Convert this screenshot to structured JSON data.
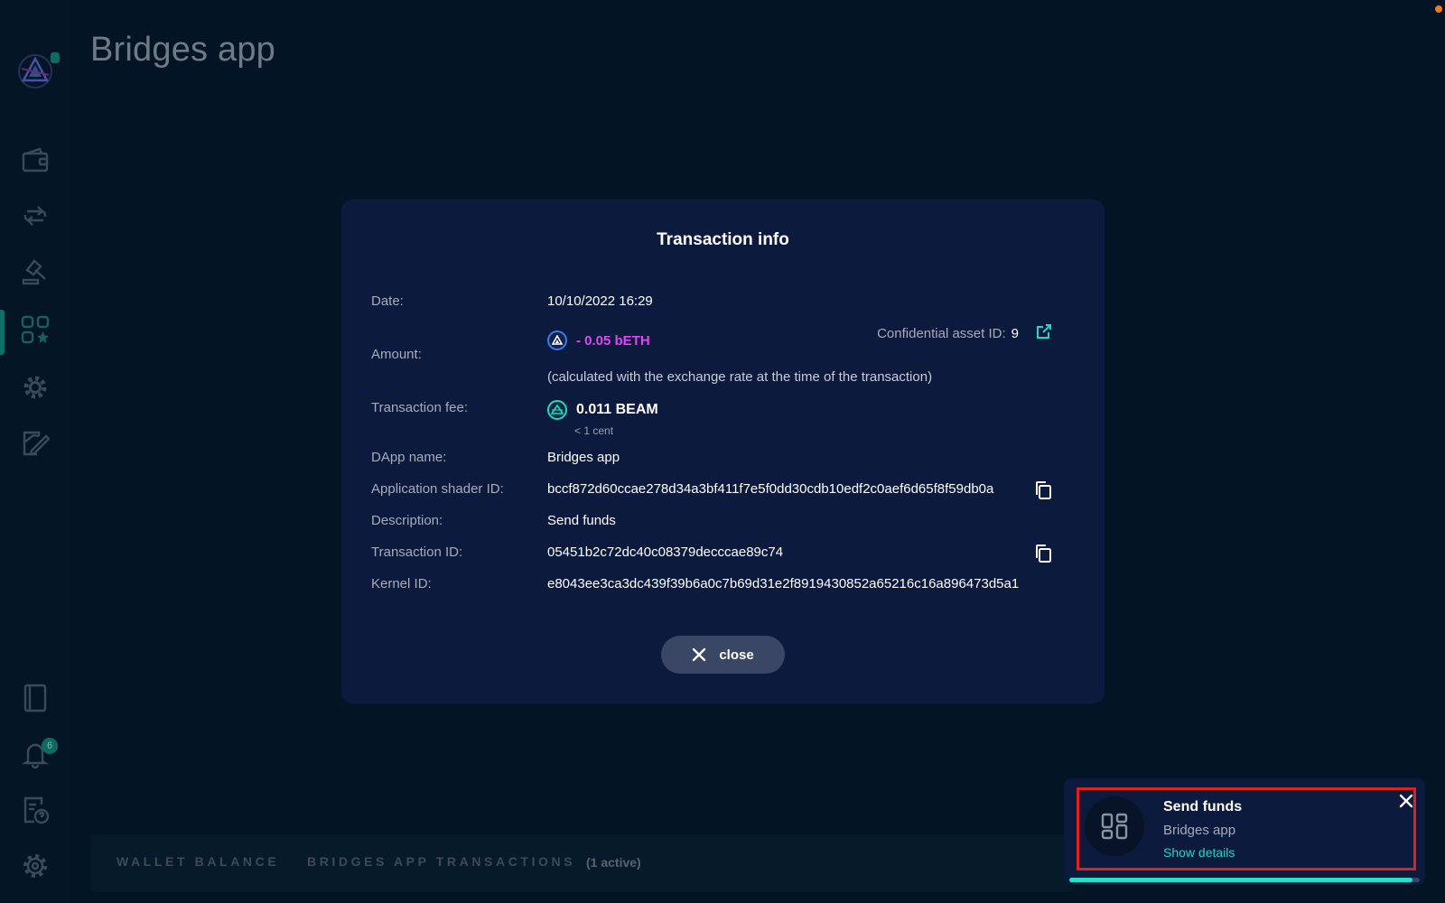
{
  "app": {
    "title": "Bridges app",
    "notifications_count": "6",
    "tabs": [
      "WALLET BALANCE",
      "BRIDGES APP TRANSACTIONS"
    ],
    "active_count": "(1 active)"
  },
  "sidebar": {
    "items": [
      "wallet",
      "transactions",
      "dao",
      "dapps",
      "settings-gear",
      "sign",
      "notes",
      "notifications",
      "help",
      "settings"
    ]
  },
  "modal": {
    "title": "Transaction info",
    "date_label": "Date:",
    "date_value": "10/10/2022  16:29",
    "amount_label": "Amount:",
    "amount_value": "- 0.05  bETH",
    "asset_label": "Confidential asset ID:",
    "asset_value": "9",
    "amount_note": "(calculated with the exchange rate at the time of the transaction)",
    "fee_label": "Transaction fee:",
    "fee_value": "0.011  BEAM",
    "fee_sub": "< 1 cent",
    "dapp_label": "DApp name:",
    "dapp_value": "Bridges app",
    "shader_label": "Application shader ID:",
    "shader_value": "bccf872d60ccae278d34a3bf411f7e5f0dd30cdb10edf2c0aef6d65f8f59db0a",
    "desc_label": "Description:",
    "desc_value": "Send funds",
    "txid_label": "Transaction ID:",
    "txid_value": "05451b2c72dc40c08379decccae89c74",
    "kernel_label": "Kernel ID:",
    "kernel_value": "e8043ee3ca3dc439f39b6a0c7b69d31e2f8919430852a65216c16a896473d5a1",
    "close_label": "close"
  },
  "toast": {
    "title": "Send funds",
    "subtitle": "Bridges app",
    "link": "Show details",
    "progress": 0.98
  },
  "colors": {
    "accent": "#25d6c3",
    "amount": "#e046f4",
    "highlight": "#e0201c"
  }
}
